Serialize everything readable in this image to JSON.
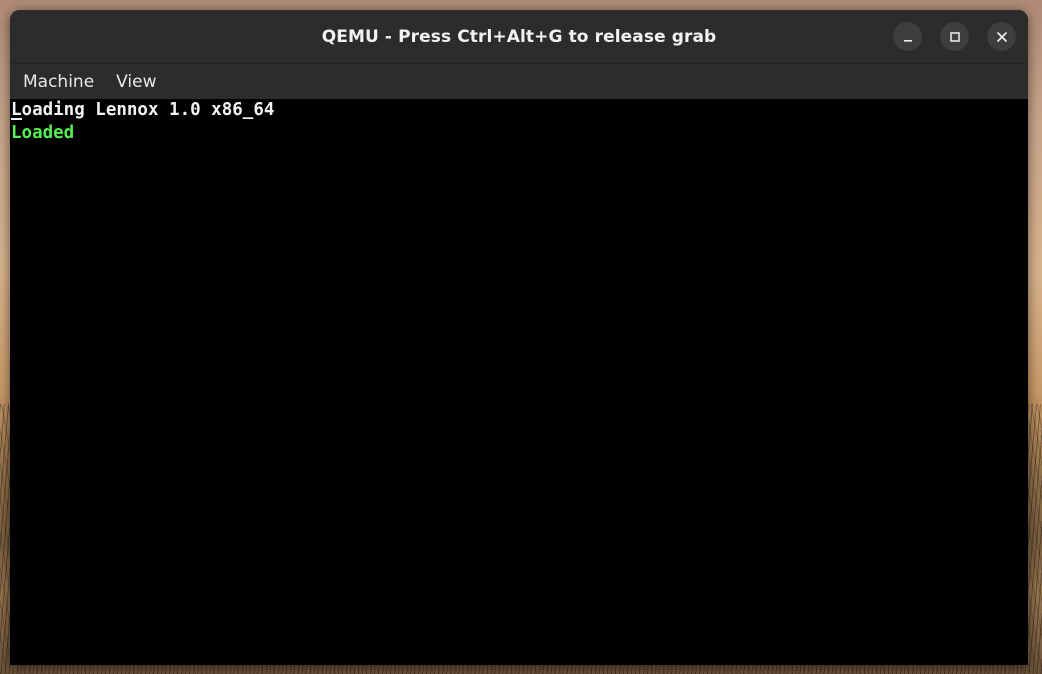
{
  "window": {
    "title": "QEMU - Press Ctrl+Alt+G to release grab",
    "controls": {
      "minimize": "minimize-icon",
      "maximize": "maximize-icon",
      "close": "close-icon"
    }
  },
  "menubar": {
    "items": [
      {
        "label": "Machine"
      },
      {
        "label": "View"
      }
    ]
  },
  "console": {
    "lines": [
      {
        "text": "Loading Lennox 1.0 x86_64",
        "color": "#f2f2f2"
      },
      {
        "text": "Loaded",
        "color": "#55ee55"
      }
    ],
    "background": "#000000"
  },
  "colors": {
    "titlebar": "#2c2c2c",
    "window_button": "#3e3e3e",
    "loaded_green": "#55ee55"
  }
}
